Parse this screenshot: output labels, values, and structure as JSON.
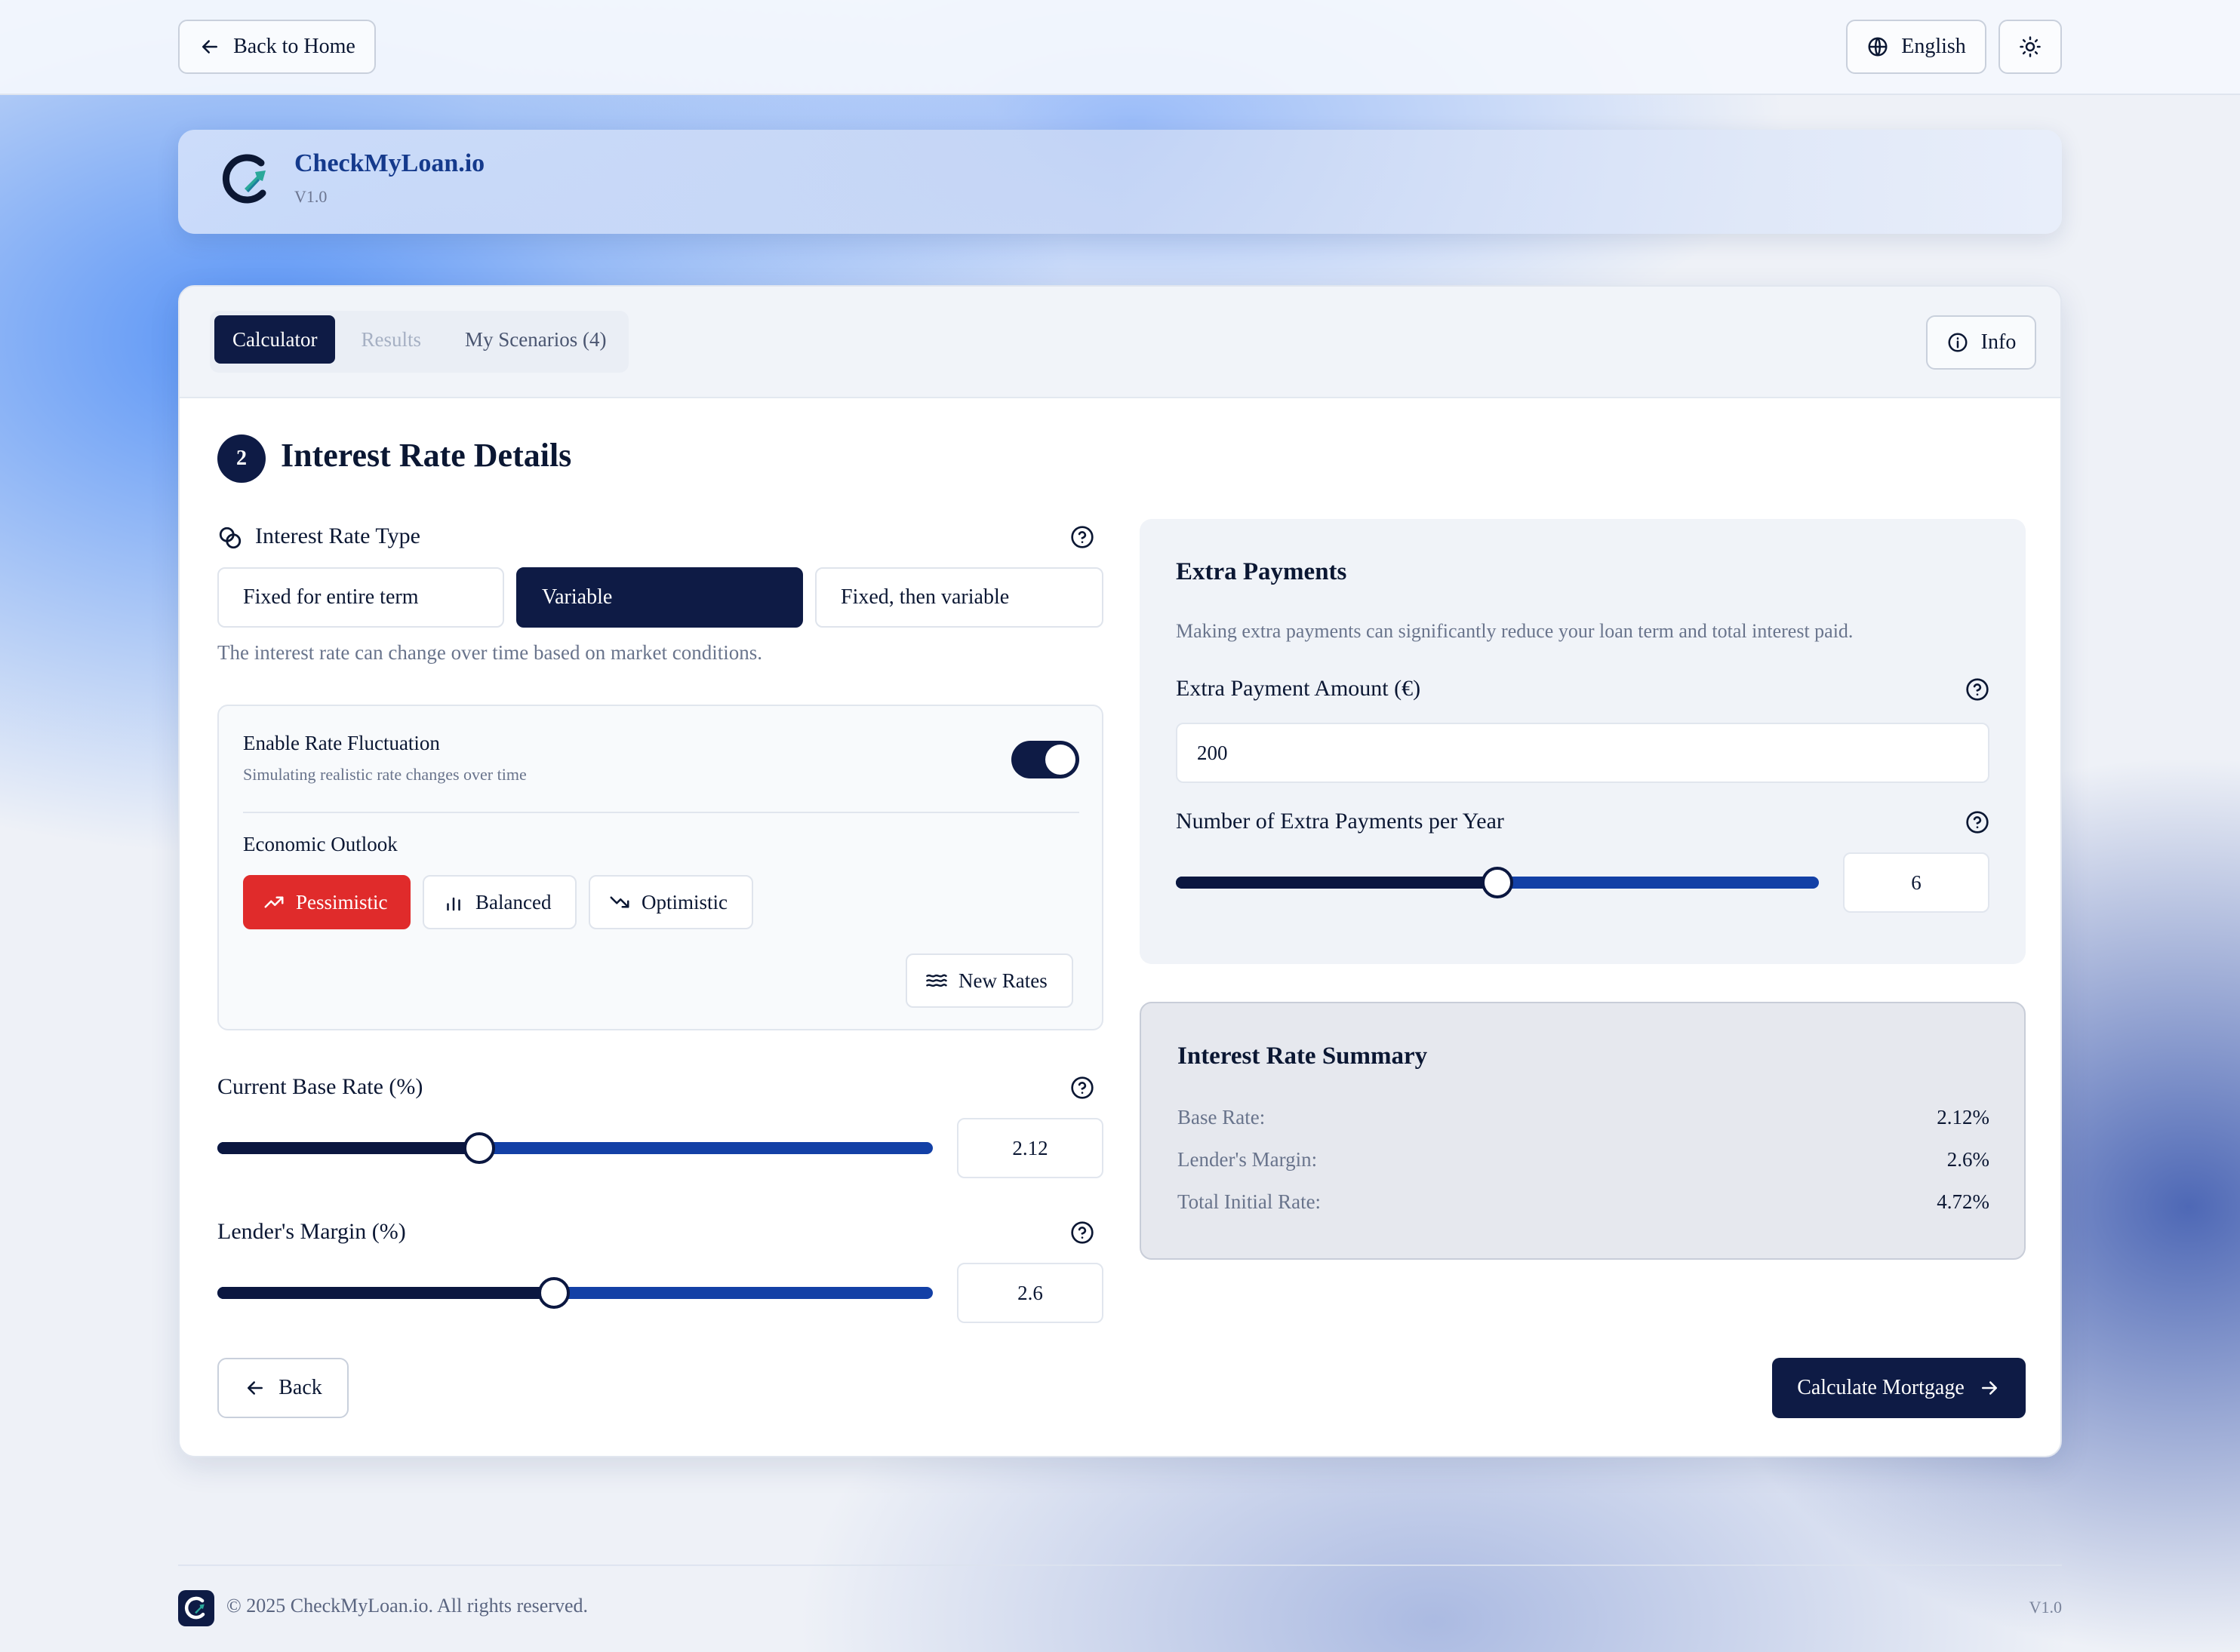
{
  "topbar": {
    "back_home": "Back to Home",
    "language": "English"
  },
  "brand": {
    "name": "CheckMyLoan.io",
    "version": "V1.0"
  },
  "tabs": {
    "calculator": "Calculator",
    "results": "Results",
    "scenarios": "My Scenarios (4)",
    "info": "Info"
  },
  "step": {
    "number": "2",
    "title": "Interest Rate Details"
  },
  "rate_type": {
    "label": "Interest Rate Type",
    "options": [
      "Fixed for entire term",
      "Variable",
      "Fixed, then variable"
    ],
    "selected": "Variable",
    "description": "The interest rate can change over time based on market conditions."
  },
  "fluctuation": {
    "title": "Enable Rate Fluctuation",
    "subtitle": "Simulating realistic rate changes over time",
    "enabled": true,
    "outlook_label": "Economic Outlook",
    "outlooks": [
      "Pessimistic",
      "Balanced",
      "Optimistic"
    ],
    "selected_outlook": "Pessimistic",
    "new_rates": "New Rates"
  },
  "base_rate": {
    "label": "Current Base Rate (%)",
    "value": "2.12",
    "fraction": 0.366
  },
  "margin": {
    "label": "Lender's Margin (%)",
    "value": "2.6",
    "fraction": 0.47
  },
  "extra": {
    "title": "Extra Payments",
    "description": "Making extra payments can significantly reduce your loan term and total interest paid.",
    "amount_label": "Extra Payment Amount (€)",
    "amount_value": "200",
    "per_year_label": "Number of Extra Payments per Year",
    "per_year_value": "6",
    "per_year_fraction": 0.5
  },
  "summary": {
    "title": "Interest Rate Summary",
    "base_label": "Base Rate:",
    "base_value": "2.12%",
    "margin_label": "Lender's Margin:",
    "margin_value": "2.6%",
    "total_label": "Total Initial Rate:",
    "total_value": "4.72%"
  },
  "actions": {
    "back": "Back",
    "calculate": "Calculate Mortgage"
  },
  "footer": {
    "copyright": "© 2025 CheckMyLoan.io. All rights reserved.",
    "version": "V1.0"
  },
  "colors": {
    "navy": "#0e1b45",
    "accent_blue": "#1340a6",
    "pessimistic_red": "#e02b2b"
  }
}
